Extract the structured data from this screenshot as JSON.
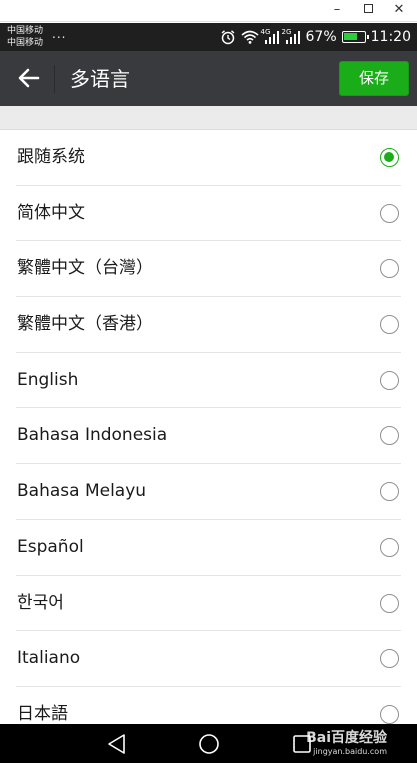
{
  "window": {
    "minimize_glyph": "–",
    "close_glyph": "✕"
  },
  "status_bar": {
    "carrier_1": "中国移动",
    "carrier_2": "中国移动",
    "overflow": "...",
    "net_1": "4G",
    "net_2": "2G",
    "battery_percent_text": "67%",
    "battery_level": 0.67,
    "time": "11:20",
    "icons": [
      "alarm-icon",
      "wifi-icon",
      "signal-icon",
      "signal-icon",
      "battery-icon"
    ]
  },
  "header": {
    "title": "多语言",
    "save_label": "保存",
    "back_icon": "arrow-left-icon"
  },
  "languages": [
    {
      "label": "跟随系统",
      "selected": true
    },
    {
      "label": "简体中文",
      "selected": false
    },
    {
      "label": "繁體中文（台灣）",
      "selected": false
    },
    {
      "label": "繁體中文（香港）",
      "selected": false
    },
    {
      "label": "English",
      "selected": false
    },
    {
      "label": "Bahasa Indonesia",
      "selected": false
    },
    {
      "label": "Bahasa Melayu",
      "selected": false
    },
    {
      "label": "Español",
      "selected": false
    },
    {
      "label": "한국어",
      "selected": false
    },
    {
      "label": "Italiano",
      "selected": false
    },
    {
      "label": "日本語",
      "selected": false
    }
  ],
  "watermark": {
    "logo": "Bai百度经验",
    "url": "jingyan.baidu.com"
  },
  "colors": {
    "accent": "#1aad19",
    "header_bg": "#393a3e",
    "status_bg": "#1f1f1f"
  }
}
